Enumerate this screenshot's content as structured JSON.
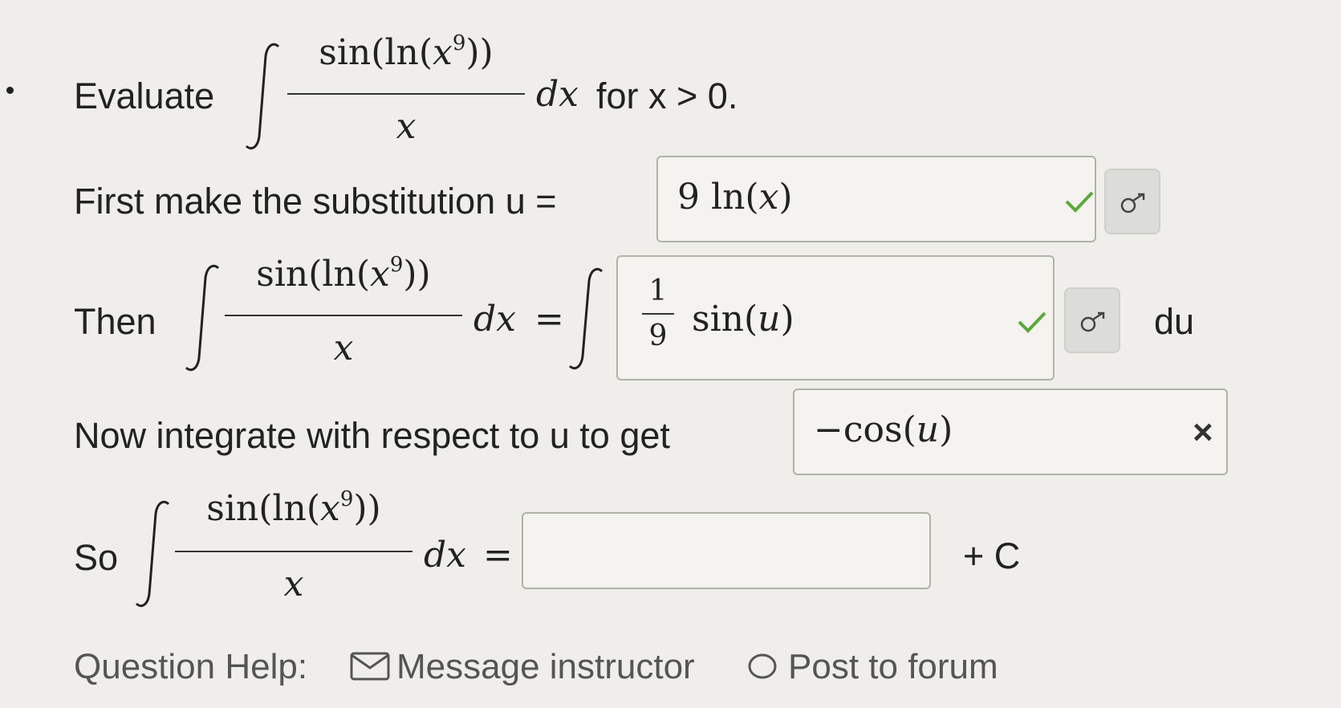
{
  "question": {
    "evaluate_label": "Evaluate",
    "for_text": "for x > 0.",
    "integrand_numerator_prefix": "sin(ln(",
    "integrand_var": "x",
    "integrand_exp": "9",
    "integrand_numerator_suffix": "))",
    "integrand_denominator": "x",
    "differential": "dx"
  },
  "step1": {
    "label": "First make the substitution u =",
    "answer_coef": "9",
    "answer_func": "ln(",
    "answer_var": "x",
    "answer_close": ")",
    "status": "correct"
  },
  "step2": {
    "label": "Then",
    "equals": "=",
    "answer_frac_num": "1",
    "answer_frac_den": "9",
    "answer_func": "sin(",
    "answer_var": "u",
    "answer_close": ")",
    "suffix": "du",
    "status": "correct"
  },
  "step3": {
    "label": "Now integrate with respect to u to get",
    "answer_prefix": "−cos(",
    "answer_var": "u",
    "answer_close": ")",
    "status": "incorrect",
    "status_symbol": "×"
  },
  "step4": {
    "label": "So",
    "equals": "=",
    "answer_value": "",
    "suffix": "+ C"
  },
  "help": {
    "question_help": "Question Help:",
    "message_instructor": "Message instructor",
    "post_to_forum": "Post to forum"
  },
  "colors": {
    "check": "#5aa93a",
    "border": "#b0b3a8",
    "background": "#efeeea"
  }
}
